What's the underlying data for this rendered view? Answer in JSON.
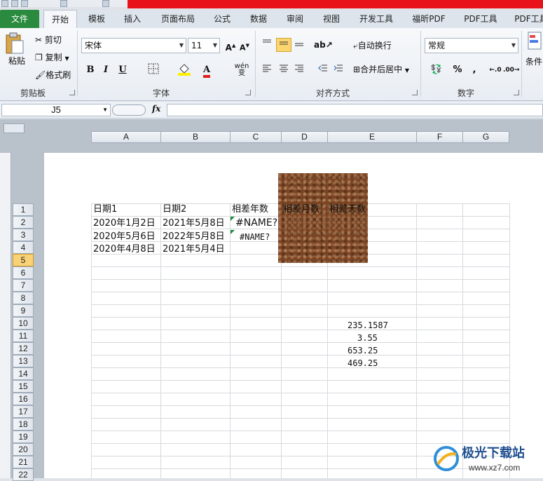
{
  "tabs": [
    "文件",
    "开始",
    "模板",
    "插入",
    "页面布局",
    "公式",
    "数据",
    "审阅",
    "视图",
    "开发工具",
    "福昕PDF",
    "PDF工具",
    "PDF工具"
  ],
  "ribbon": {
    "clipboard": {
      "paste": "粘贴",
      "cut": "剪切",
      "copy": "复制",
      "format_painter": "格式刷",
      "group_label": "剪贴板"
    },
    "font": {
      "font_name": "宋体",
      "font_size": "11",
      "group_label": "字体",
      "bold": "B",
      "italic": "I",
      "underline": "U",
      "wen": "wén 变"
    },
    "alignment": {
      "wrap_text": "自动换行",
      "merge_center": "合并后居中",
      "group_label": "对齐方式"
    },
    "number": {
      "format": "常规",
      "percent": "%",
      "comma": ",",
      "group_label": "数字"
    },
    "styles": {
      "conditional": "条件"
    }
  },
  "formula_bar": {
    "name_box": "J5",
    "fx": "fx",
    "value": ""
  },
  "columns": [
    "A",
    "B",
    "C",
    "D",
    "E",
    "F",
    "G"
  ],
  "rows": [
    "1",
    "2",
    "3",
    "4",
    "5",
    "6",
    "7",
    "8",
    "9",
    "10",
    "11",
    "12",
    "13",
    "14",
    "15",
    "16",
    "17",
    "18",
    "19",
    "20",
    "21",
    "22"
  ],
  "selected_row": "5",
  "cells": {
    "A1": "日期1",
    "B1": "日期2",
    "C1": "相差年数",
    "D1": "相差月数",
    "E1": "相差天数",
    "A2": "2020年1月2日",
    "B2": "2021年5月8日",
    "C2": "#NAME?",
    "A3": "2020年5月6日",
    "B3": "2022年5月8日",
    "C3": "#NAME?",
    "A4": "2020年4月8日",
    "B4": "2021年5月4日",
    "E10": "235.1587",
    "E11": "3.55",
    "E12": "653.25",
    "E13": "469.25"
  },
  "watermark": {
    "text": "极光下载站",
    "url": "www.xz7.com"
  }
}
